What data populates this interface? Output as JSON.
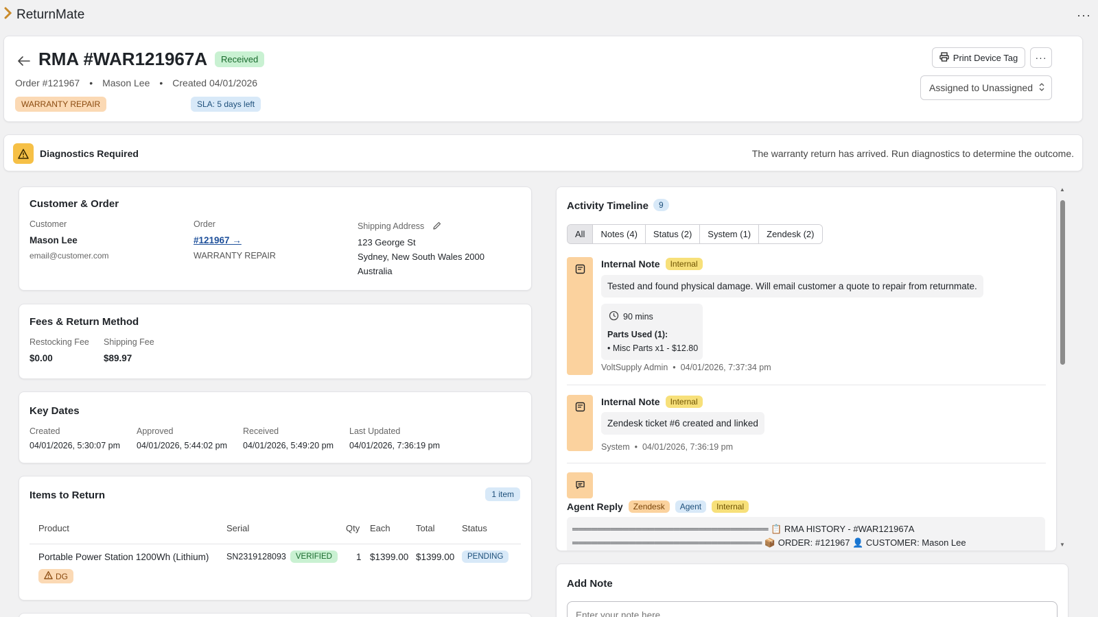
{
  "app": {
    "name": "ReturnMate",
    "more_label": "···"
  },
  "header": {
    "rma_title": "RMA #WAR121967A",
    "status_badge": "Received",
    "order_label": "Order #121967",
    "customer_name": "Mason Lee",
    "created_label": "Created 04/01/2026",
    "type_badge": "WARRANTY REPAIR",
    "sla_badge": "SLA: 5 days left",
    "print_button": "Print Device Tag",
    "more_button": "···",
    "assign_label": "Assigned to Unassigned"
  },
  "alert": {
    "title": "Diagnostics Required",
    "message": "The warranty return has arrived. Run diagnostics to determine the outcome."
  },
  "customer_order": {
    "title": "Customer & Order",
    "customer_label": "Customer",
    "customer_name": "Mason Lee",
    "customer_email": "email@customer.com",
    "order_label": "Order",
    "order_link": "#121967 →",
    "order_type": "WARRANTY REPAIR",
    "shipping_label": "Shipping Address",
    "address_line1": "123 George St",
    "address_line2": "Sydney, New South Wales 2000",
    "address_line3": "Australia"
  },
  "fees": {
    "title": "Fees & Return Method",
    "restocking_label": "Restocking Fee",
    "restocking_value": "$0.00",
    "shipping_label": "Shipping Fee",
    "shipping_value": "$89.97"
  },
  "key_dates": {
    "title": "Key Dates",
    "items": [
      {
        "label": "Created",
        "value": "04/01/2026, 5:30:07 pm"
      },
      {
        "label": "Approved",
        "value": "04/01/2026, 5:44:02 pm"
      },
      {
        "label": "Received",
        "value": "04/01/2026, 5:49:20 pm"
      },
      {
        "label": "Last Updated",
        "value": "04/01/2026, 7:36:19 pm"
      }
    ]
  },
  "items": {
    "title": "Items to Return",
    "count_badge": "1 item",
    "columns": [
      "Product",
      "Serial",
      "Qty",
      "Each",
      "Total",
      "Status"
    ],
    "rows": [
      {
        "product": "Portable Power Station 1200Wh (Lithium)",
        "serial": "SN2319128093",
        "serial_badge": "VERIFIED",
        "qty": "1",
        "each": "$1399.00",
        "total": "$1399.00",
        "status": "PENDING",
        "hazard_badge": "DG"
      }
    ]
  },
  "timeline": {
    "title": "Activity Timeline",
    "count": "9",
    "tabs": [
      "All",
      "Notes (4)",
      "Status (2)",
      "System (1)",
      "Zendesk (2)"
    ],
    "active_tab": "All",
    "entries": [
      {
        "title": "Internal Note",
        "tag": "Internal",
        "body": "Tested and found physical damage. Will email customer a quote to repair from returnmate.",
        "time_spent": "90 mins",
        "parts_title": "Parts Used (1):",
        "parts_item": "• Misc Parts x1 - $12.80",
        "author": "VoltSupply Admin",
        "timestamp": "04/01/2026, 7:37:34 pm"
      },
      {
        "title": "Internal Note",
        "tag": "Internal",
        "body": "Zendesk ticket #6 created and linked",
        "author": "System",
        "timestamp": "04/01/2026, 7:36:19 pm"
      },
      {
        "title": "Agent Reply",
        "tags": [
          "Zendesk",
          "Agent",
          "Internal"
        ],
        "code_line1": "═══════════════════════════════ 📋 RMA HISTORY - #WAR121967A",
        "code_line2": "══════════════════════════════ 📦 ORDER: #121967 👤 CUSTOMER: Mason Lee"
      }
    ]
  },
  "add_note": {
    "title": "Add Note",
    "placeholder": "Enter your note here..."
  },
  "colors": {
    "accent_orange": "#fbd29e",
    "internal_yellow": "#f7e07a",
    "success_green": "#c9f1d2",
    "info_blue": "#d8e9f8",
    "warning_icon": "#f6c046"
  },
  "icons": [
    "chevron-right-icon",
    "back-arrow-icon",
    "printer-icon",
    "warning-icon",
    "pencil-icon",
    "note-icon",
    "clock-icon",
    "chat-icon"
  ]
}
